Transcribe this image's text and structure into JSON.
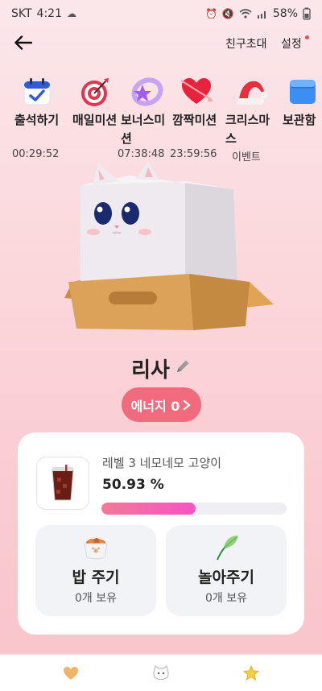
{
  "status_bar": {
    "carrier": "SKT",
    "time": "4:21",
    "battery": "58%"
  },
  "top_nav": {
    "invite_label": "친구초대",
    "settings_label": "설정"
  },
  "missions": [
    {
      "label": "출석하기",
      "sub": "00:29:52",
      "icon": "calendar-check-icon"
    },
    {
      "label": "매일미션",
      "sub": "",
      "icon": "dartboard-icon"
    },
    {
      "label": "보너스미션",
      "sub": "07:38:48",
      "icon": "star-ring-icon"
    },
    {
      "label": "깜짝미션",
      "sub": "23:59:56",
      "icon": "arrow-heart-icon"
    },
    {
      "label": "크리스마스",
      "sub": "이벤트",
      "icon": "santa-hat-icon"
    },
    {
      "label": "보관함",
      "sub": "",
      "icon": "storage-box-icon"
    }
  ],
  "pet": {
    "name": "리사",
    "energy_label": "에너지 0"
  },
  "progress": {
    "level_label": "레벨 3 네모네모 고양이",
    "percent_text": "50.93 %",
    "percent": 50.93
  },
  "actions": {
    "feed": {
      "title": "밥 주기",
      "sub": "0개 보유",
      "icon": "food-bowl-icon"
    },
    "play": {
      "title": "놀아주기",
      "sub": "0개 보유",
      "icon": "leaf-toy-icon"
    }
  },
  "bottom_tabs": [
    {
      "icon": "heart-tab-icon"
    },
    {
      "icon": "cat-face-tab-icon"
    },
    {
      "icon": "star-tab-icon"
    }
  ],
  "colors": {
    "accent": "#f26b7c",
    "bar_start": "#f27a98",
    "bar_end": "#f553c4"
  }
}
